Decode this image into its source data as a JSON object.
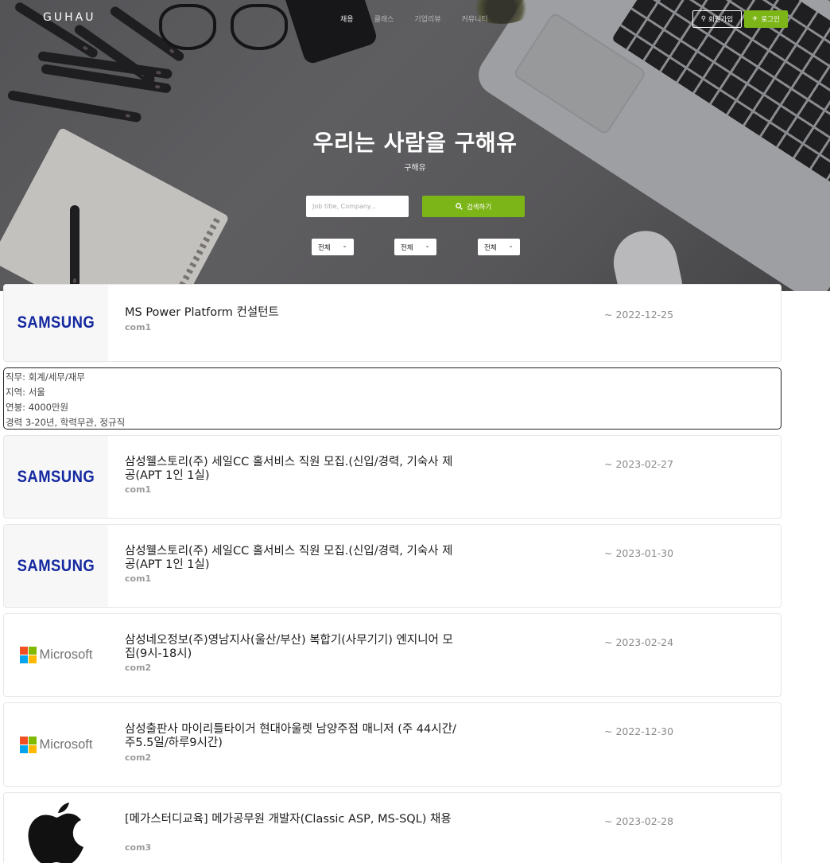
{
  "header": {
    "brand": "GUHAU",
    "nav": [
      "채용",
      "클래스",
      "기업리뷰",
      "커뮤니티"
    ],
    "signup_label": "회원가입",
    "login_label": "로그인"
  },
  "hero": {
    "title": "우리는 사람을 구해유",
    "subtitle": "구해유",
    "search_placeholder": "Job title, Company...",
    "search_button": "검색하기",
    "filters": [
      "전체",
      "전체",
      "전체"
    ]
  },
  "detail_panel": {
    "lines": [
      "직무: 회계/세무/재무",
      "지역: 서울",
      "연봉: 4000만원",
      "경력 3-20년, 학력무관, 정규직"
    ]
  },
  "listings": [
    {
      "logo": "SAMSUNG",
      "title": "MS Power Platform 컨설턴트",
      "company": "com1",
      "date": "~ 2022-12-25"
    },
    {
      "logo": "SAMSUNG",
      "title": "삼성웰스토리(주) 세일CC 홀서비스 직원 모집.(신입/경력, 기숙사 제공(APT 1인 1실)",
      "company": "com1",
      "date": "~ 2023-02-27"
    },
    {
      "logo": "SAMSUNG",
      "title": "삼성웰스토리(주) 세일CC 홀서비스 직원 모집.(신입/경력, 기숙사 제공(APT 1인 1실)",
      "company": "com1",
      "date": "~ 2023-01-30"
    },
    {
      "logo": "Microsoft",
      "title": "삼성네오정보(주)영남지사(울산/부산) 복합기(사무기기) 엔지니어 모집(9시-18시)",
      "company": "com2",
      "date": "~ 2023-02-24"
    },
    {
      "logo": "Microsoft",
      "title": "삼성출판사 마이리틀타이거 현대아울렛 남양주점 매니저 (주 44시간/주5.5일/하루9시간)",
      "company": "com2",
      "date": "~ 2022-12-30"
    },
    {
      "logo": "apple",
      "title": "[메가스터디교육] 메가공무원 개발자(Classic ASP, MS-SQL) 채용",
      "company": "com3",
      "date": "~ 2023-02-28"
    }
  ],
  "colors": {
    "accent": "#7cb518",
    "samsung_blue": "#1428a0"
  }
}
